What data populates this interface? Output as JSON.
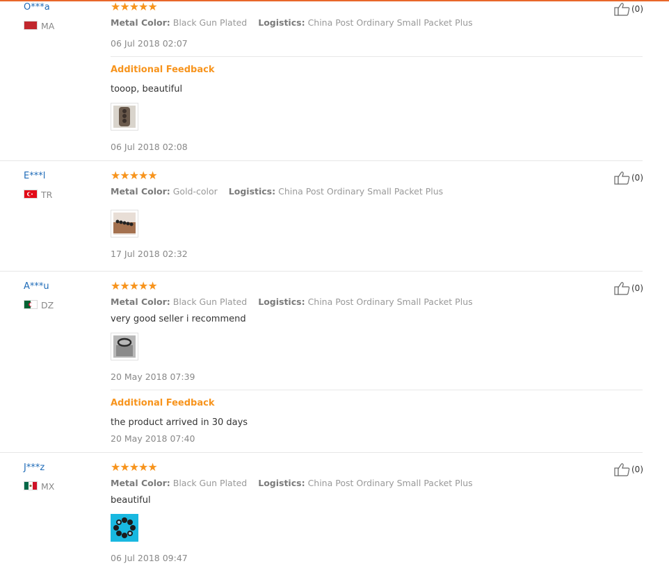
{
  "labels": {
    "metal_color": "Metal Color:",
    "logistics": "Logistics:",
    "additional_feedback": "Additional Feedback"
  },
  "rating_glyph": "★★★★★",
  "colors": {
    "accent": "#f7941d",
    "link": "#1e6bb8",
    "top_rule": "#e8672a"
  },
  "reviews": [
    {
      "user": "O***a",
      "country": "MA",
      "flag_icon": "morocco-flag-icon",
      "stars": 5,
      "metal_color": "Black Gun Plated",
      "logistics": "China Post Ordinary Small Packet Plus",
      "date": "06 Jul 2018 02:07",
      "likes": "(0)",
      "additional": {
        "text": "tooop, beautiful",
        "date": "06 Jul 2018 02:08"
      }
    },
    {
      "user": "E***l",
      "country": "TR",
      "flag_icon": "turkey-flag-icon",
      "stars": 5,
      "metal_color": "Gold-color",
      "logistics": "China Post Ordinary Small Packet Plus",
      "date": "17 Jul 2018 02:32",
      "likes": "(0)"
    },
    {
      "user": "A***u",
      "country": "DZ",
      "flag_icon": "algeria-flag-icon",
      "stars": 5,
      "metal_color": "Black Gun Plated",
      "logistics": "China Post Ordinary Small Packet Plus",
      "text": "very good seller i recommend",
      "date": "20 May 2018 07:39",
      "likes": "(0)",
      "additional": {
        "text": "the product arrived in 30 days",
        "date": "20 May 2018 07:40"
      }
    },
    {
      "user": "J***z",
      "country": "MX",
      "flag_icon": "mexico-flag-icon",
      "stars": 5,
      "metal_color": "Black Gun Plated",
      "logistics": "China Post Ordinary Small Packet Plus",
      "text": "beautiful",
      "date": "06 Jul 2018 09:47",
      "likes": "(0)"
    }
  ]
}
